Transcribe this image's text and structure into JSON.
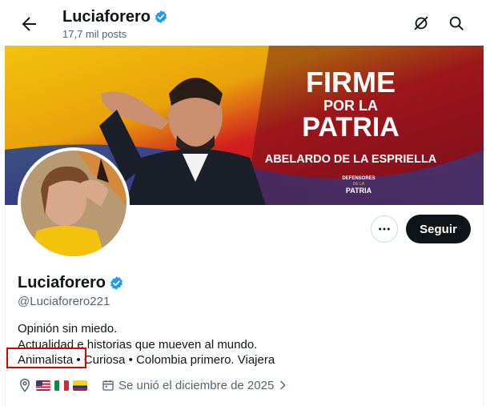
{
  "header": {
    "back_icon": "arrow-left-icon",
    "title": "Luciaforero",
    "posts_count": "17,7 mil posts",
    "grok_icon": "grok-icon",
    "search_icon": "search-icon"
  },
  "banner": {
    "headline_line1": "FIRME",
    "headline_line2": "POR LA",
    "headline_line3": "PATRIA",
    "candidate": "ABELARDO DE LA ESPRIELLA",
    "logo_top": "DEFENSORES",
    "logo_mid": "DE LA",
    "logo_bottom": "PATRIA"
  },
  "actions": {
    "more_icon": "more-horizontal-icon",
    "follow_label": "Seguir"
  },
  "profile": {
    "name": "Luciaforero",
    "handle": "@Luciaforero221",
    "bio_line1": "Opinión sin miedo.",
    "bio_line2": "Actualidad e historias que mueven al mundo.",
    "bio_line3_a": "Animalista",
    "bio_line3_b": " • Curiosa • Colombia primero. Viajera",
    "joined": "Se unió el diciembre de 2025"
  },
  "colors": {
    "verified": "#1d9bf0",
    "highlight_box": "#e00000",
    "follow_bg": "#0f1419",
    "muted_text": "#536471"
  }
}
